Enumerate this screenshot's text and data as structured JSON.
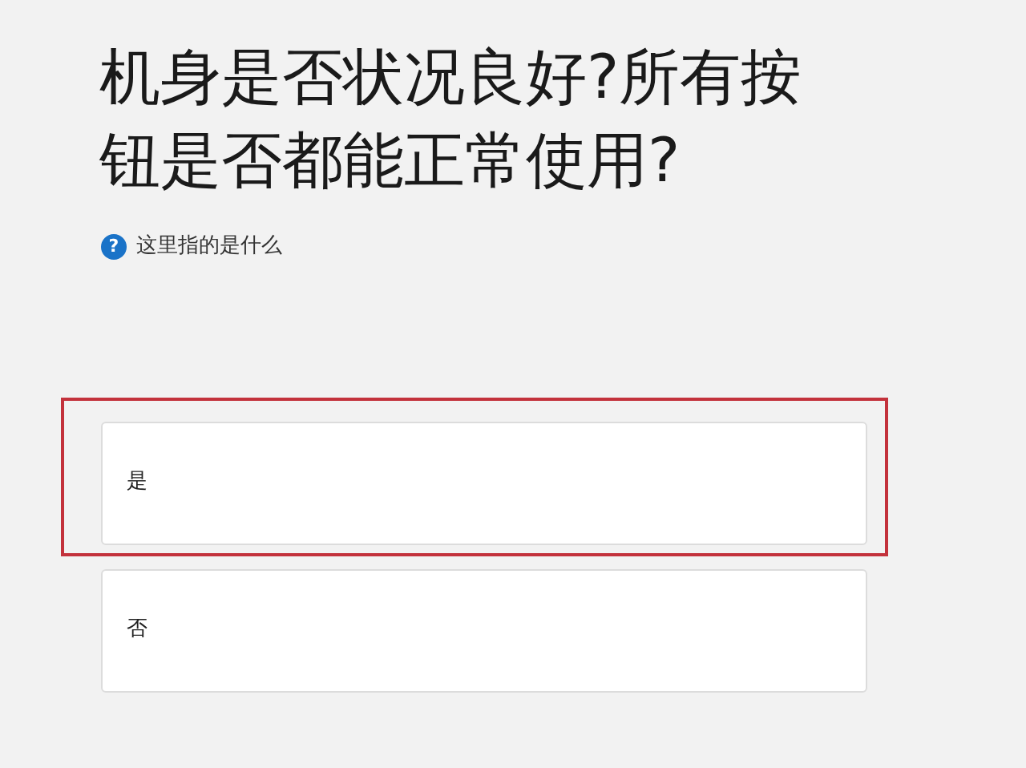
{
  "question": {
    "title": "机身是否状况良好?所有按钮是否都能正常使用?",
    "help_icon": "?",
    "help_text": "这里指的是什么"
  },
  "options": [
    {
      "label": "是",
      "selected": true
    },
    {
      "label": "否",
      "selected": false
    }
  ]
}
